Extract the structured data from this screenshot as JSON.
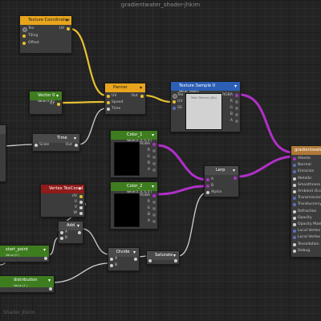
{
  "window": {
    "title": "gradientwater_shader-jhkim",
    "footer": "Shader jhkim"
  },
  "colors": {
    "wire_yellow": "#e8c230",
    "wire_purple": "#b030c8",
    "wire_white": "#cfcfcf",
    "wire_blue": "#5a6fbd",
    "header_orange": "#e8a41c",
    "header_blue": "#2c5fb5",
    "header_green": "#3e7d1f",
    "header_red": "#8f1b1b"
  },
  "nodes": {
    "texcoord": {
      "title": "Texture Coordinates",
      "inputs": [
        "Tex",
        "Tiling",
        "Offset"
      ],
      "output": "UV"
    },
    "vector0": {
      "title": "Vector 0",
      "subtitle": "Value (1,0 )",
      "output": "XY"
    },
    "panner": {
      "title": "Panner",
      "inputs": [
        "UV",
        "Speed",
        "Time"
      ],
      "output": "Out"
    },
    "texsample": {
      "title": "Texture Sample 0",
      "subtitle": "Value: <Null>",
      "inputs": [
        "Tex",
        "UV",
        "SS"
      ],
      "outputs": [
        "RGBA",
        "R",
        "G",
        "B",
        "A"
      ],
      "preview_label": "Main Texture (Alb)"
    },
    "time": {
      "title": "Time",
      "inputs": [
        "Scale"
      ],
      "output": "Out"
    },
    "color1": {
      "title": "Color_1",
      "subtitle": "Value (1, 0, 0, 0 )",
      "outputs": [
        "RGBA",
        "R",
        "G",
        "B",
        "A"
      ]
    },
    "color2": {
      "title": "Color_2",
      "subtitle": "Value (1, 0, 0, 0 )",
      "outputs": [
        "RGBA",
        "R",
        "G",
        "B",
        "A"
      ]
    },
    "lerp": {
      "title": "Lerp",
      "inputs": [
        "A",
        "B",
        "Alpha"
      ]
    },
    "vertex_texcoord": {
      "title": "Vertex TexCoord",
      "outputs": [
        "UV",
        "U",
        "V",
        "W"
      ]
    },
    "add": {
      "title": "Add",
      "inputs": [
        "A",
        "B"
      ]
    },
    "start_point": {
      "title": "start_point",
      "subtitle": "Value (0 )"
    },
    "distribution": {
      "title": "distribution",
      "subtitle": "Value (1 )"
    },
    "divide": {
      "title": "Divide",
      "inputs": [
        "A",
        "B"
      ]
    },
    "saturate": {
      "title": "Saturate"
    },
    "master": {
      "title": "gradientwater_sh",
      "inputs": [
        "Albedo",
        "Normal",
        "Emission",
        "Metallic",
        "Smoothness",
        "Ambient Occlusion",
        "Transmission",
        "Translucency",
        "Refraction",
        "Opacity",
        "Opacity Mask",
        "Local Vertex Offset",
        "Local Vertex Normal",
        "Tessellation",
        "Debug"
      ]
    }
  }
}
